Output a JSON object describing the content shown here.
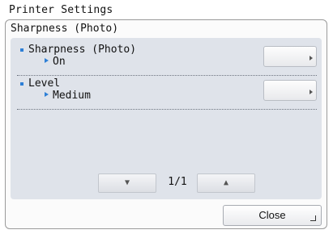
{
  "window": {
    "title": "Printer Settings"
  },
  "dialog": {
    "title": "Sharpness (Photo)"
  },
  "settings": [
    {
      "label": "Sharpness (Photo)",
      "value": "On"
    },
    {
      "label": "Level",
      "value": "Medium"
    }
  ],
  "pager": {
    "prev_icon": "down-arrow-icon",
    "next_icon": "up-arrow-icon",
    "prev_glyph": "▼",
    "next_glyph": "▲",
    "indicator": "1/1"
  },
  "actions": {
    "close_label": "Close"
  },
  "colors": {
    "accent": "#2d7fd6",
    "panel": "#dfe3ea"
  }
}
